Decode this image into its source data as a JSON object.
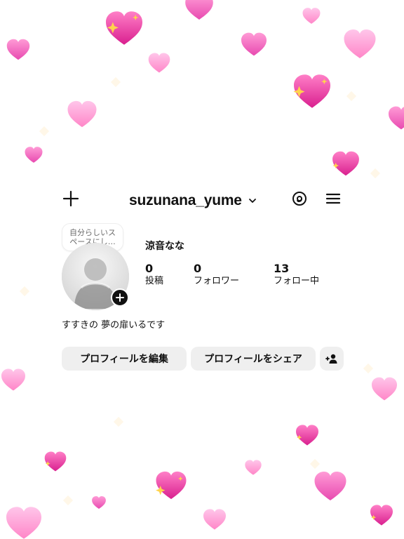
{
  "colors": {
    "accent": "#e83da9",
    "text": "#111111",
    "button_bg": "#efefef"
  },
  "icons": {
    "new_post": "plus-icon",
    "account_switch": "chevron-down-icon",
    "threads": "threads-icon",
    "menu": "menu-icon",
    "add_story": "plus-icon",
    "discover_people": "add-person-icon"
  },
  "header": {
    "username": "suzunana_yume"
  },
  "profile": {
    "note": "自分らしいス\nペースにし…",
    "display_name": "涼音なな",
    "stats": [
      {
        "value": "0",
        "label": "投稿"
      },
      {
        "value": "0",
        "label": "フォロワー"
      },
      {
        "value": "13",
        "label": "フォロー中"
      }
    ],
    "bio": "すすきの 夢の扉いるです"
  },
  "actions": {
    "edit_profile": "プロフィールを編集",
    "share_profile": "プロフィールをシェア"
  }
}
